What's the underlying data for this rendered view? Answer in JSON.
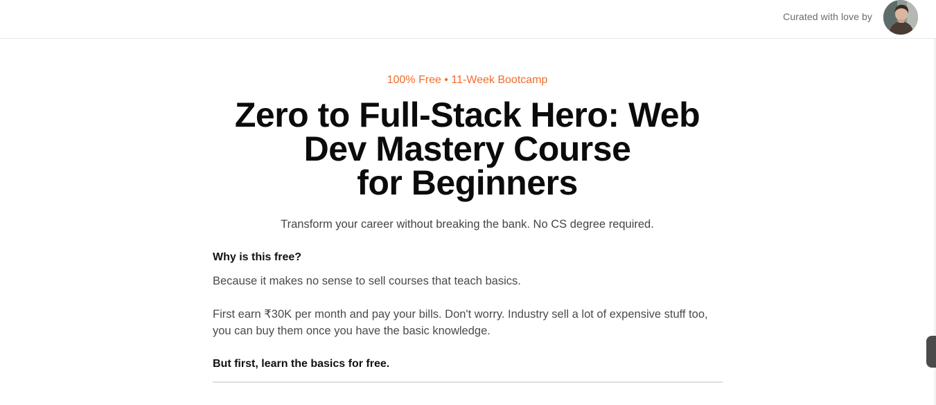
{
  "header": {
    "curated_text": "Curated with love by",
    "avatar_icon": "avatar-photo"
  },
  "hero": {
    "eyebrow": "100% Free • 11-Week Bootcamp",
    "title_lines": [
      "Zero to Full-Stack Hero: Web",
      "Dev Mastery Course",
      "for Beginners"
    ],
    "subtitle": "Transform your career without breaking the bank. No CS degree required."
  },
  "faq": {
    "question": "Why is this free?",
    "paragraphs": [
      "Because it makes no sense to sell courses that teach basics.",
      "First earn ₹30K per month and pay your bills. Don't worry. Industry sell a lot of expensive stuff too, you can buy them once you have the basic knowledge."
    ],
    "closing": "But first, learn the basics for free."
  },
  "colors": {
    "accent": "#f26b2a",
    "text": "#111111",
    "muted": "#4a4a4a"
  }
}
